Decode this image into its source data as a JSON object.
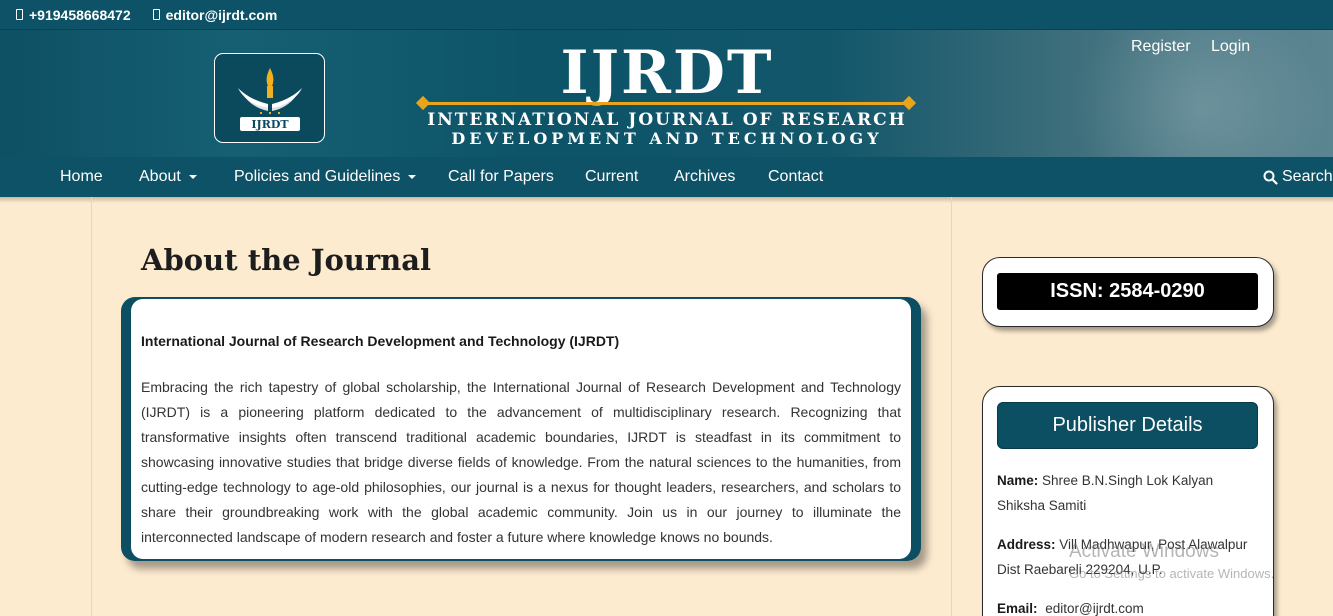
{
  "topbar": {
    "phone": "+919458668472",
    "email": "editor@ijrdt.com"
  },
  "header": {
    "logo_text": "IJRDT",
    "title": "IJRDT",
    "subtitle_line1": "INTERNATIONAL JOURNAL OF RESEARCH",
    "subtitle_line2": "DEVELOPMENT AND TECHNOLOGY",
    "register": "Register",
    "login": "Login"
  },
  "nav": {
    "items": [
      {
        "label": "Home"
      },
      {
        "label": "About"
      },
      {
        "label": "Policies and Guidelines"
      },
      {
        "label": "Call for Papers"
      },
      {
        "label": "Current"
      },
      {
        "label": "Archives"
      },
      {
        "label": "Contact"
      }
    ],
    "search": "Search"
  },
  "main": {
    "heading": "About the Journal",
    "card_title": "International Journal of Research Development and Technology (IJRDT)",
    "card_body": "Embracing the rich tapestry of global scholarship, the International Journal of Research Development and Technology (IJRDT) is a pioneering platform dedicated to the advancement of multidisciplinary research. Recognizing that transformative insights often transcend traditional academic boundaries, IJRDT is steadfast in its commitment to showcasing innovative studies that bridge diverse fields of knowledge. From the natural sciences to the humanities, from cutting-edge technology to age-old philosophies, our journal is a nexus for thought leaders, researchers, and scholars to share their groundbreaking work with the global academic community. Join us in our journey to illuminate the interconnected landscape of modern research and foster a future where knowledge knows no bounds."
  },
  "sidebar": {
    "issn": "ISSN: 2584-0290",
    "publisher_heading": "Publisher Details",
    "name_label": "Name:",
    "name_value": "Shree B.N.Singh Lok Kalyan Shiksha Samiti",
    "address_label": "Address:",
    "address_value": "Vill Madhwapur, Post Alawalpur Dist Raebareli 229204, U.P.",
    "email_label": "Email:",
    "email_value": "editor@ijrdt.com"
  },
  "watermark": {
    "line1": "Activate Windows",
    "line2": "Go to Settings to activate Windows."
  },
  "colors": {
    "primary": "#0d5266",
    "accent": "#e8a51c",
    "page_bg": "#fdebd0"
  }
}
